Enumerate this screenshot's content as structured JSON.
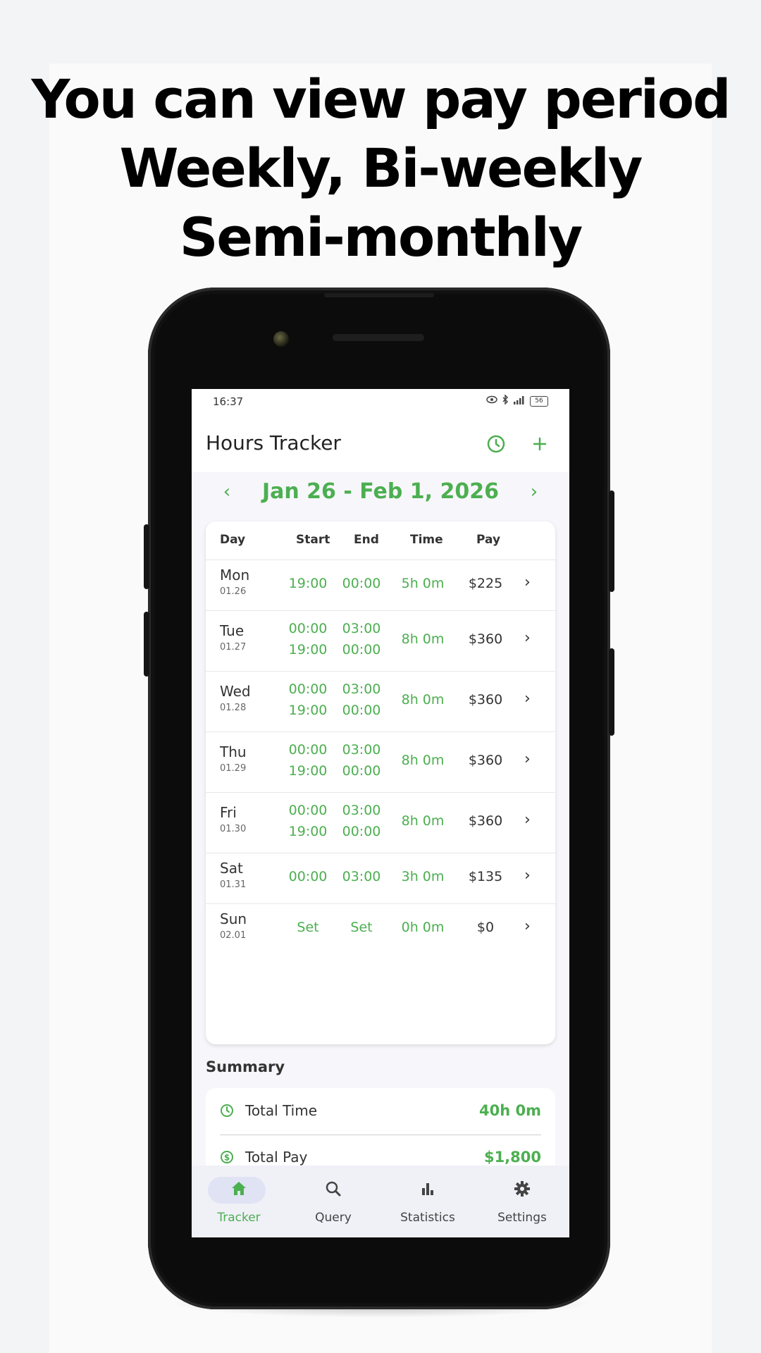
{
  "headline": [
    "You can view pay period",
    "Weekly, Bi-weekly",
    "Semi-monthly"
  ],
  "status": {
    "time": "16:37",
    "battery": "56"
  },
  "app": {
    "title": "Hours Tracker"
  },
  "period": {
    "label": "Jan 26 - Feb 1, 2026",
    "prev": "‹",
    "next": "›"
  },
  "table": {
    "headers": {
      "day": "Day",
      "start": "Start",
      "end": "End",
      "time": "Time",
      "pay": "Pay"
    },
    "rows": [
      {
        "day": "Mon",
        "date": "01.26",
        "starts": [
          "19:00"
        ],
        "ends": [
          "00:00"
        ],
        "time": "5h 0m",
        "pay": "$225"
      },
      {
        "day": "Tue",
        "date": "01.27",
        "starts": [
          "00:00",
          "19:00"
        ],
        "ends": [
          "03:00",
          "00:00"
        ],
        "time": "8h 0m",
        "pay": "$360"
      },
      {
        "day": "Wed",
        "date": "01.28",
        "starts": [
          "00:00",
          "19:00"
        ],
        "ends": [
          "03:00",
          "00:00"
        ],
        "time": "8h 0m",
        "pay": "$360"
      },
      {
        "day": "Thu",
        "date": "01.29",
        "starts": [
          "00:00",
          "19:00"
        ],
        "ends": [
          "03:00",
          "00:00"
        ],
        "time": "8h 0m",
        "pay": "$360"
      },
      {
        "day": "Fri",
        "date": "01.30",
        "starts": [
          "00:00",
          "19:00"
        ],
        "ends": [
          "03:00",
          "00:00"
        ],
        "time": "8h 0m",
        "pay": "$360"
      },
      {
        "day": "Sat",
        "date": "01.31",
        "starts": [
          "00:00"
        ],
        "ends": [
          "03:00"
        ],
        "time": "3h 0m",
        "pay": "$135"
      },
      {
        "day": "Sun",
        "date": "02.01",
        "starts": [
          "Set"
        ],
        "ends": [
          "Set"
        ],
        "time": "0h 0m",
        "pay": "$0"
      }
    ]
  },
  "summary": {
    "title": "Summary",
    "total_time_label": "Total Time",
    "total_time": "40h 0m",
    "total_pay_label": "Total Pay",
    "total_pay": "$1,800"
  },
  "nav": [
    {
      "label": "Tracker",
      "icon": "home-icon",
      "active": true
    },
    {
      "label": "Query",
      "icon": "search-icon",
      "active": false
    },
    {
      "label": "Statistics",
      "icon": "bar-chart-icon",
      "active": false
    },
    {
      "label": "Settings",
      "icon": "gear-icon",
      "active": false
    }
  ],
  "colors": {
    "accent": "#4caf50",
    "text": "#333333",
    "nav_bg": "#f0f0f7",
    "pill": "#dfe3f4"
  }
}
